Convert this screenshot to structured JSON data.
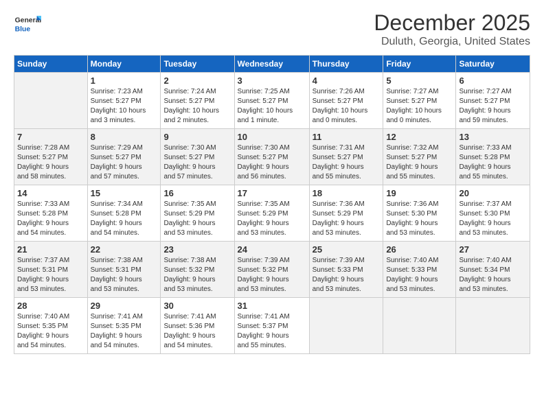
{
  "logo": {
    "text_general": "General",
    "text_blue": "Blue"
  },
  "title": "December 2025",
  "subtitle": "Duluth, Georgia, United States",
  "headers": [
    "Sunday",
    "Monday",
    "Tuesday",
    "Wednesday",
    "Thursday",
    "Friday",
    "Saturday"
  ],
  "weeks": [
    [
      {
        "day": "",
        "info": ""
      },
      {
        "day": "1",
        "info": "Sunrise: 7:23 AM\nSunset: 5:27 PM\nDaylight: 10 hours\nand 3 minutes."
      },
      {
        "day": "2",
        "info": "Sunrise: 7:24 AM\nSunset: 5:27 PM\nDaylight: 10 hours\nand 2 minutes."
      },
      {
        "day": "3",
        "info": "Sunrise: 7:25 AM\nSunset: 5:27 PM\nDaylight: 10 hours\nand 1 minute."
      },
      {
        "day": "4",
        "info": "Sunrise: 7:26 AM\nSunset: 5:27 PM\nDaylight: 10 hours\nand 0 minutes."
      },
      {
        "day": "5",
        "info": "Sunrise: 7:27 AM\nSunset: 5:27 PM\nDaylight: 10 hours\nand 0 minutes."
      },
      {
        "day": "6",
        "info": "Sunrise: 7:27 AM\nSunset: 5:27 PM\nDaylight: 9 hours\nand 59 minutes."
      }
    ],
    [
      {
        "day": "7",
        "info": "Sunrise: 7:28 AM\nSunset: 5:27 PM\nDaylight: 9 hours\nand 58 minutes."
      },
      {
        "day": "8",
        "info": "Sunrise: 7:29 AM\nSunset: 5:27 PM\nDaylight: 9 hours\nand 57 minutes."
      },
      {
        "day": "9",
        "info": "Sunrise: 7:30 AM\nSunset: 5:27 PM\nDaylight: 9 hours\nand 57 minutes."
      },
      {
        "day": "10",
        "info": "Sunrise: 7:30 AM\nSunset: 5:27 PM\nDaylight: 9 hours\nand 56 minutes."
      },
      {
        "day": "11",
        "info": "Sunrise: 7:31 AM\nSunset: 5:27 PM\nDaylight: 9 hours\nand 55 minutes."
      },
      {
        "day": "12",
        "info": "Sunrise: 7:32 AM\nSunset: 5:27 PM\nDaylight: 9 hours\nand 55 minutes."
      },
      {
        "day": "13",
        "info": "Sunrise: 7:33 AM\nSunset: 5:28 PM\nDaylight: 9 hours\nand 55 minutes."
      }
    ],
    [
      {
        "day": "14",
        "info": "Sunrise: 7:33 AM\nSunset: 5:28 PM\nDaylight: 9 hours\nand 54 minutes."
      },
      {
        "day": "15",
        "info": "Sunrise: 7:34 AM\nSunset: 5:28 PM\nDaylight: 9 hours\nand 54 minutes."
      },
      {
        "day": "16",
        "info": "Sunrise: 7:35 AM\nSunset: 5:29 PM\nDaylight: 9 hours\nand 53 minutes."
      },
      {
        "day": "17",
        "info": "Sunrise: 7:35 AM\nSunset: 5:29 PM\nDaylight: 9 hours\nand 53 minutes."
      },
      {
        "day": "18",
        "info": "Sunrise: 7:36 AM\nSunset: 5:29 PM\nDaylight: 9 hours\nand 53 minutes."
      },
      {
        "day": "19",
        "info": "Sunrise: 7:36 AM\nSunset: 5:30 PM\nDaylight: 9 hours\nand 53 minutes."
      },
      {
        "day": "20",
        "info": "Sunrise: 7:37 AM\nSunset: 5:30 PM\nDaylight: 9 hours\nand 53 minutes."
      }
    ],
    [
      {
        "day": "21",
        "info": "Sunrise: 7:37 AM\nSunset: 5:31 PM\nDaylight: 9 hours\nand 53 minutes."
      },
      {
        "day": "22",
        "info": "Sunrise: 7:38 AM\nSunset: 5:31 PM\nDaylight: 9 hours\nand 53 minutes."
      },
      {
        "day": "23",
        "info": "Sunrise: 7:38 AM\nSunset: 5:32 PM\nDaylight: 9 hours\nand 53 minutes."
      },
      {
        "day": "24",
        "info": "Sunrise: 7:39 AM\nSunset: 5:32 PM\nDaylight: 9 hours\nand 53 minutes."
      },
      {
        "day": "25",
        "info": "Sunrise: 7:39 AM\nSunset: 5:33 PM\nDaylight: 9 hours\nand 53 minutes."
      },
      {
        "day": "26",
        "info": "Sunrise: 7:40 AM\nSunset: 5:33 PM\nDaylight: 9 hours\nand 53 minutes."
      },
      {
        "day": "27",
        "info": "Sunrise: 7:40 AM\nSunset: 5:34 PM\nDaylight: 9 hours\nand 53 minutes."
      }
    ],
    [
      {
        "day": "28",
        "info": "Sunrise: 7:40 AM\nSunset: 5:35 PM\nDaylight: 9 hours\nand 54 minutes."
      },
      {
        "day": "29",
        "info": "Sunrise: 7:41 AM\nSunset: 5:35 PM\nDaylight: 9 hours\nand 54 minutes."
      },
      {
        "day": "30",
        "info": "Sunrise: 7:41 AM\nSunset: 5:36 PM\nDaylight: 9 hours\nand 54 minutes."
      },
      {
        "day": "31",
        "info": "Sunrise: 7:41 AM\nSunset: 5:37 PM\nDaylight: 9 hours\nand 55 minutes."
      },
      {
        "day": "",
        "info": ""
      },
      {
        "day": "",
        "info": ""
      },
      {
        "day": "",
        "info": ""
      }
    ]
  ]
}
